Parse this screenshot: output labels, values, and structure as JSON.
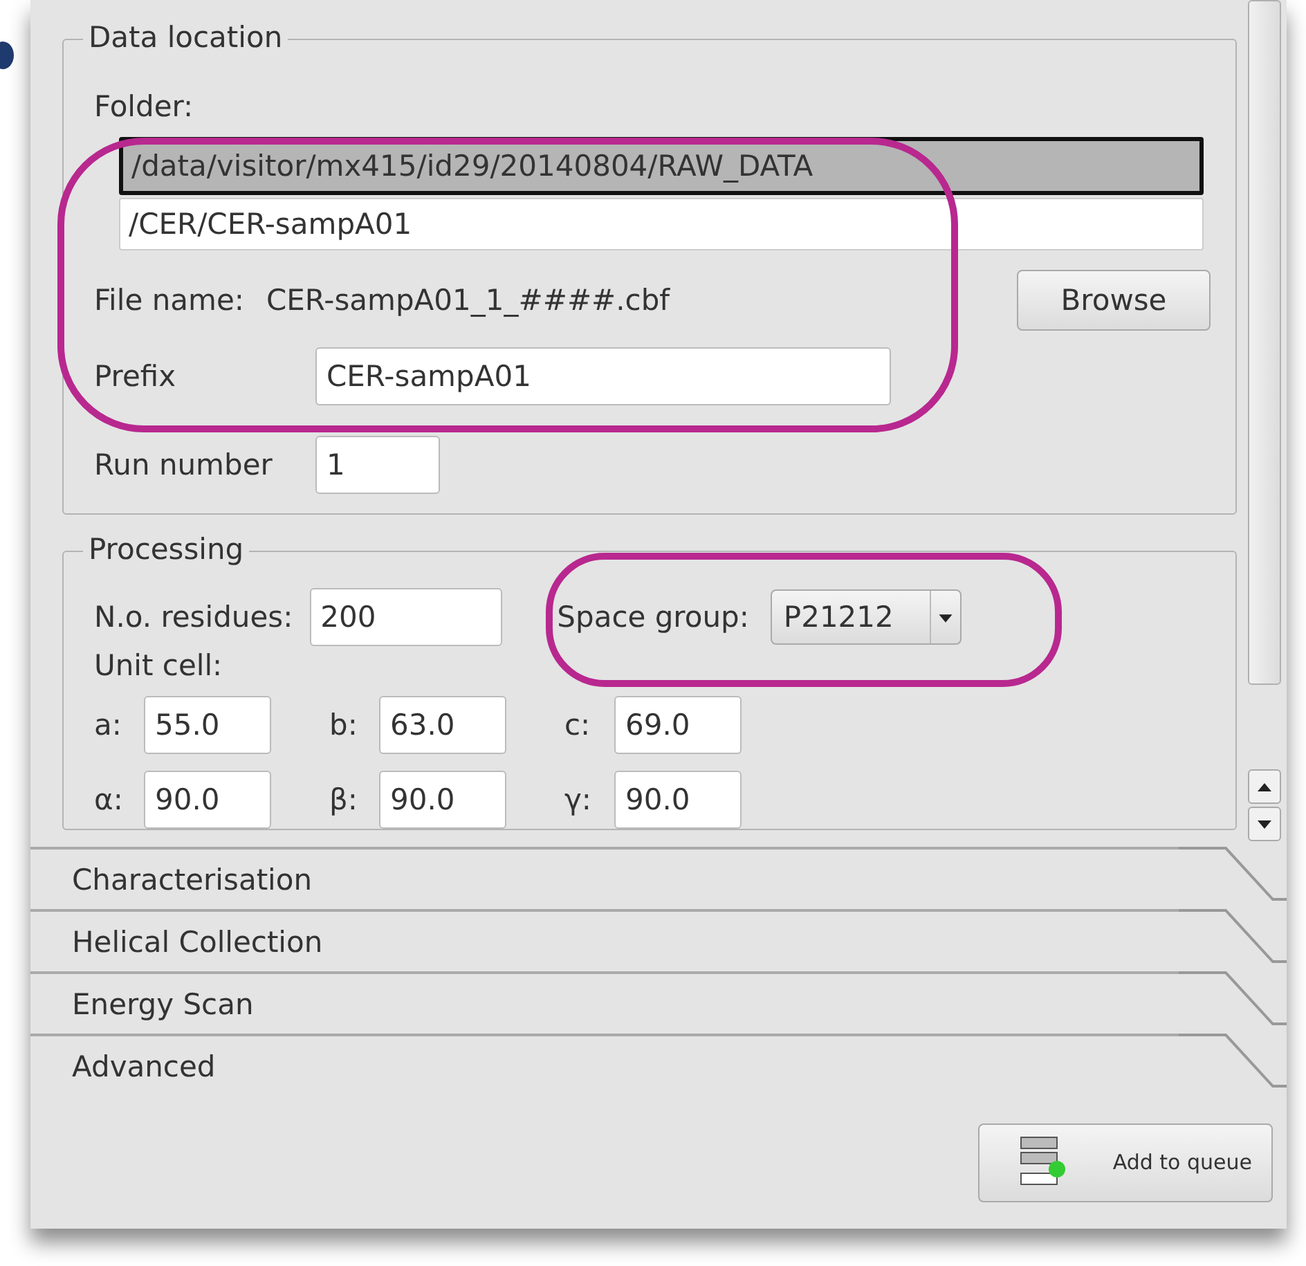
{
  "data_location": {
    "title": "Data location",
    "folder_label": "Folder:",
    "folder_lines": [
      {
        "text": "/data/visitor/mx415/id29/20140804/RAW_DATA",
        "selected": true
      },
      {
        "text": "/CER/CER-sampA01",
        "selected": false
      }
    ],
    "file_name_label": "File name:",
    "file_name": "CER-sampA01_1_####.cbf",
    "browse_button": "Browse",
    "prefix_label": "Prefix",
    "prefix": "CER-sampA01",
    "run_number_label": "Run number",
    "run_number": "1"
  },
  "processing": {
    "title": "Processing",
    "residues_label": "N.o. residues:",
    "residues": "200",
    "space_group_label": "Space group:",
    "space_group": "P21212",
    "unit_cell_label": "Unit cell:",
    "cell": [
      {
        "label": "a:",
        "value": "55.0"
      },
      {
        "label": "b:",
        "value": "63.0"
      },
      {
        "label": "c:",
        "value": "69.0"
      },
      {
        "label": "α:",
        "value": "90.0"
      },
      {
        "label": "β:",
        "value": "90.0"
      },
      {
        "label": "γ:",
        "value": "90.0"
      }
    ]
  },
  "sections": [
    "Characterisation",
    "Helical Collection",
    "Energy Scan",
    "Advanced"
  ],
  "add_button": "Add to queue"
}
